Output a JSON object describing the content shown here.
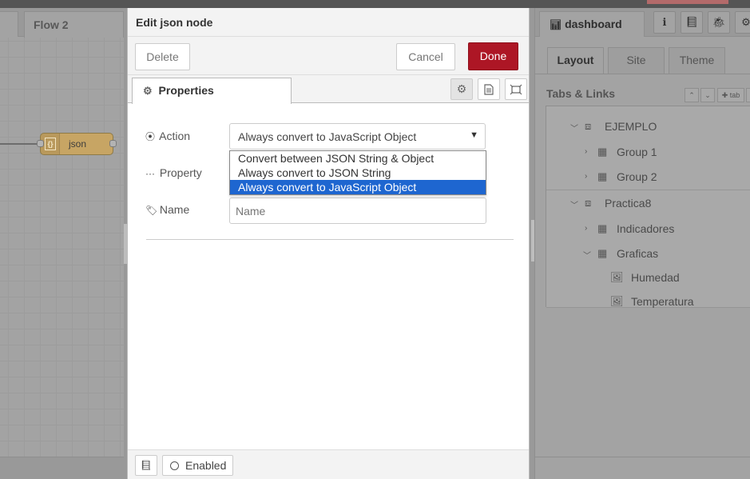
{
  "workspace": {
    "flow_tab": "Flow 2",
    "node_label": "json",
    "node_icon_glyph": "{}"
  },
  "tray": {
    "title": "Edit json node",
    "delete_label": "Delete",
    "cancel_label": "Cancel",
    "done_label": "Done",
    "properties_tab": "Properties",
    "action_label": "Action",
    "property_label": "Property",
    "name_label": "Name",
    "action_selected": "Always convert to JavaScript Object",
    "action_options": [
      "Convert between JSON String & Object",
      "Always convert to JSON String",
      "Always convert to JavaScript Object"
    ],
    "name_placeholder": "Name",
    "enabled_label": "Enabled"
  },
  "sidebar": {
    "tab_label": "dashboard",
    "subtabs": [
      "Layout",
      "Site",
      "Theme"
    ],
    "section_title": "Tabs & Links",
    "tab_button_label": "tab",
    "tree": [
      {
        "label": "EJEMPLO",
        "kind": "tab"
      },
      {
        "label": "Group 1",
        "kind": "group"
      },
      {
        "label": "Group 2",
        "kind": "group"
      },
      {
        "label": "Practica8",
        "kind": "tab"
      },
      {
        "label": "Indicadores",
        "kind": "group"
      },
      {
        "label": "Graficas",
        "kind": "group"
      },
      {
        "label": "Humedad",
        "kind": "widget"
      },
      {
        "label": "Temperatura",
        "kind": "widget"
      }
    ]
  },
  "colors": {
    "done_button": "#ad1625",
    "selected_option": "#1e66d0",
    "node_fill": "#c7a564"
  }
}
